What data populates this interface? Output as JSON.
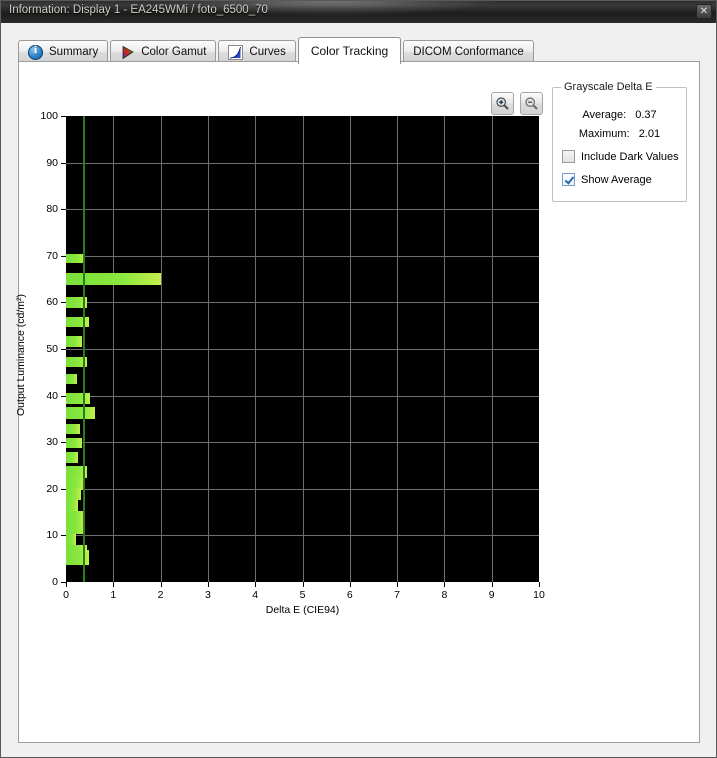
{
  "window": {
    "title": "Information: Display 1 - EA245WMi / foto_6500_70",
    "close_label": "✕"
  },
  "tabs": [
    {
      "label": "Summary",
      "icon": "info-icon",
      "active": false
    },
    {
      "label": "Color Gamut",
      "icon": "gamut-icon",
      "active": false
    },
    {
      "label": "Curves",
      "icon": "curves-icon",
      "active": false
    },
    {
      "label": "Color Tracking",
      "icon": "",
      "active": true
    },
    {
      "label": "DICOM Conformance",
      "icon": "",
      "active": false
    }
  ],
  "toolbar": {
    "zoom_in_label": "zoom-in-icon",
    "zoom_out_label": "zoom-out-icon"
  },
  "side_panel": {
    "group_title": "Grayscale Delta E",
    "average_label": "Average:",
    "average_value": "0.37",
    "maximum_label": "Maximum:",
    "maximum_value": "2.01",
    "include_dark_values_label": "Include Dark Values",
    "include_dark_values_checked": false,
    "show_average_label": "Show Average",
    "show_average_checked": true
  },
  "chart_data": {
    "type": "bar",
    "orientation": "horizontal",
    "title": "",
    "xlabel": "Delta E (CIE94)",
    "ylabel": "Output Luminance (cd/m²)",
    "xlim": [
      0,
      10
    ],
    "ylim": [
      0,
      100
    ],
    "xticks": [
      0,
      1,
      2,
      3,
      4,
      5,
      6,
      7,
      8,
      9,
      10
    ],
    "yticks": [
      0,
      10,
      20,
      30,
      40,
      50,
      60,
      70,
      80,
      90,
      100
    ],
    "grid": true,
    "plot_background": "#000000",
    "bar_color": "#8ce83f",
    "average_line": {
      "value": 0.37,
      "color": "#2a7a1e",
      "label": "Show Average"
    },
    "series_name": "Grayscale Delta E",
    "x_name": "Delta E (CIE94)",
    "y_name": "Output Luminance (cd/m²)",
    "points": [
      {
        "luminance": 69.5,
        "delta_e": 0.4,
        "thickness": 1.9
      },
      {
        "luminance": 65.0,
        "delta_e": 2.01,
        "thickness": 2.6
      },
      {
        "luminance": 60.0,
        "delta_e": 0.44,
        "thickness": 2.2
      },
      {
        "luminance": 55.8,
        "delta_e": 0.48,
        "thickness": 2.2
      },
      {
        "luminance": 51.6,
        "delta_e": 0.33,
        "thickness": 2.2
      },
      {
        "luminance": 47.2,
        "delta_e": 0.45,
        "thickness": 2.2
      },
      {
        "luminance": 43.5,
        "delta_e": 0.23,
        "thickness": 2.2
      },
      {
        "luminance": 39.4,
        "delta_e": 0.5,
        "thickness": 2.2
      },
      {
        "luminance": 36.3,
        "delta_e": 0.62,
        "thickness": 2.6
      },
      {
        "luminance": 32.8,
        "delta_e": 0.3,
        "thickness": 2.2
      },
      {
        "luminance": 29.9,
        "delta_e": 0.33,
        "thickness": 2.2
      },
      {
        "luminance": 26.7,
        "delta_e": 0.26,
        "thickness": 2.2
      },
      {
        "luminance": 23.6,
        "delta_e": 0.44,
        "thickness": 2.6
      },
      {
        "luminance": 21.0,
        "delta_e": 0.38,
        "thickness": 2.6
      },
      {
        "luminance": 18.8,
        "delta_e": 0.31,
        "thickness": 2.6
      },
      {
        "luminance": 16.4,
        "delta_e": 0.26,
        "thickness": 2.6
      },
      {
        "luminance": 14.0,
        "delta_e": 0.4,
        "thickness": 2.6
      },
      {
        "luminance": 11.6,
        "delta_e": 0.4,
        "thickness": 2.6
      },
      {
        "luminance": 9.1,
        "delta_e": 0.22,
        "thickness": 2.2
      },
      {
        "luminance": 6.8,
        "delta_e": 0.44,
        "thickness": 2.2
      },
      {
        "luminance": 5.2,
        "delta_e": 0.48,
        "thickness": 3.3
      }
    ]
  }
}
